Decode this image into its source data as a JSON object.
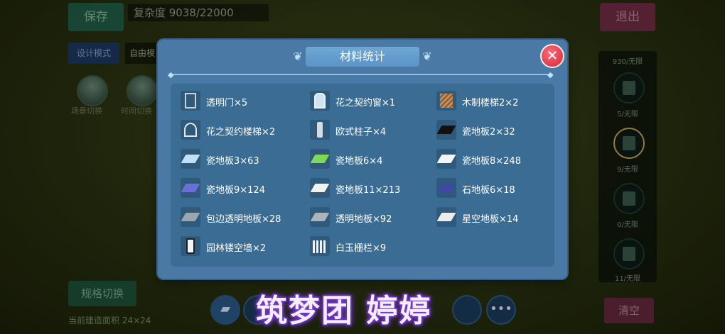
{
  "background": {
    "save_label": "保存",
    "complexity_text": "复杂度 9038/22000",
    "design_mode_label": "设计模式",
    "mode_value": "自由模",
    "exit_label": "退出",
    "right_panel": {
      "counter_top": "930/无限",
      "slot_labels": [
        "5/无限",
        "9/无限",
        "0/无限",
        "11/无限"
      ]
    },
    "clear_label": "清空",
    "spec_switch_label": "规格切换",
    "area_text": "当前建造面积 24×24",
    "circle_labels": [
      "场景切换",
      "时间切换"
    ]
  },
  "watermark": "筑梦团 婷婷",
  "modal": {
    "title": "材料统计",
    "close_label": "✕",
    "items": [
      {
        "label": "透明门×5",
        "icon": "door-icon"
      },
      {
        "label": "花之契约窗×1",
        "icon": "window-icon"
      },
      {
        "label": "木制楼梯2×2",
        "icon": "wooden-stairs-icon"
      },
      {
        "label": "花之契约楼梯×2",
        "icon": "spiral-stairs-icon"
      },
      {
        "label": "欧式柱子×4",
        "icon": "pillar-icon"
      },
      {
        "label": "瓷地板2×32",
        "icon": "tile-icon"
      },
      {
        "label": "瓷地板3×63",
        "icon": "tile-icon"
      },
      {
        "label": "瓷地板6×4",
        "icon": "tile-icon"
      },
      {
        "label": "瓷地板8×248",
        "icon": "tile-icon"
      },
      {
        "label": "瓷地板9×124",
        "icon": "tile-icon"
      },
      {
        "label": "瓷地板11×213",
        "icon": "tile-icon"
      },
      {
        "label": "石地板6×18",
        "icon": "tile-icon"
      },
      {
        "label": "包边透明地板×28",
        "icon": "tile-icon"
      },
      {
        "label": "透明地板×92",
        "icon": "tile-icon"
      },
      {
        "label": "星空地板×14",
        "icon": "tile-icon"
      },
      {
        "label": "园林镂空墙×2",
        "icon": "wall-icon"
      },
      {
        "label": "白玉栅栏×9",
        "icon": "fence-icon"
      }
    ]
  },
  "colors": {
    "modal_bg": "#4a79a6",
    "content_bg": "#3b6d94",
    "close_red": "#d1263a",
    "tile_colors": [
      "#111111",
      "#bfe1f3",
      "#7ed957",
      "#f4f4f4",
      "#6a6fd8",
      "#f0f0f0",
      "#3d4aa0",
      "#9aa6b0",
      "#aab4bc",
      "#ececec"
    ]
  }
}
